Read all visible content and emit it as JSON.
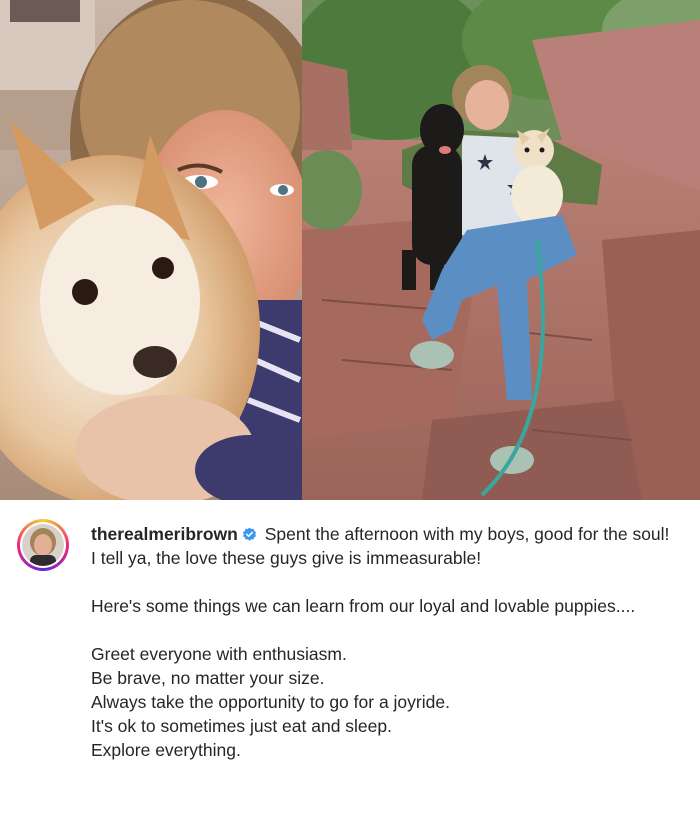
{
  "post": {
    "username": "therealmeribrown",
    "verified_icon": "verified-badge-icon",
    "accent_color": "#3897f0",
    "caption_first": " Spent the afternoon with my boys, good for the soul!",
    "caption_lines": [
      "I tell ya, the love these guys give is immeasurable!",
      "",
      "Here's some things we can learn from our loyal and lovable puppies....",
      "",
      "Greet everyone with enthusiasm.",
      "Be brave, no matter your size.",
      "Always take the opportunity to go for a joyride.",
      "It's ok to sometimes just eat and sleep.",
      "Explore everything."
    ]
  },
  "media": {
    "left_photo": "selfie-with-dog-photo",
    "right_photo": "woman-with-two-dogs-on-rocks-photo"
  }
}
